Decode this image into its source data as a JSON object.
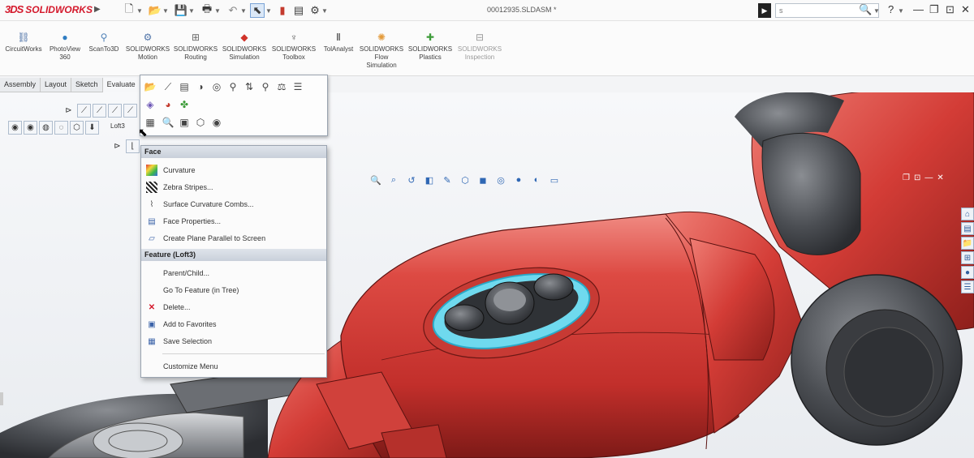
{
  "app": {
    "brand": "SOLIDWORKS",
    "brand_prefix": "3DS",
    "document_title": "00012935.SLDASM *"
  },
  "quick_access": [
    "new-icon",
    "open-icon",
    "save-icon",
    "print-icon",
    "undo-icon",
    "select-icon",
    "rebuild-icon",
    "file-properties-icon",
    "options-icon"
  ],
  "search": {
    "placeholder": "",
    "value": "s"
  },
  "window_controls": [
    "help-icon",
    "minimize-icon",
    "restore-icon",
    "close-icon"
  ],
  "command_manager": {
    "tools": [
      {
        "label": "CircuitWorks",
        "color": "#4a6fa5"
      },
      {
        "label": "PhotoView 360",
        "color": "#2f7dc2"
      },
      {
        "label": "ScanTo3D",
        "color": "#5082b8"
      },
      {
        "label": "SOLIDWORKS Motion",
        "color": "#4f73a8"
      },
      {
        "label": "SOLIDWORKS Routing",
        "color": "#6a6a6a"
      },
      {
        "label": "SOLIDWORKS Simulation",
        "color": "#d0332a"
      },
      {
        "label": "SOLIDWORKS Toolbox",
        "color": "#6b6b6b"
      },
      {
        "label": "TolAnalyst",
        "color": "#3b3b3b"
      },
      {
        "label": "SOLIDWORKS Flow Simulation",
        "color": "#e39a3a"
      },
      {
        "label": "SOLIDWORKS Plastics",
        "color": "#3e9c3a"
      },
      {
        "label": "SOLIDWORKS Inspection",
        "color": "#9a9a9a"
      }
    ]
  },
  "tabs": [
    "Assembly",
    "Layout",
    "Sketch",
    "Evaluate"
  ],
  "context_toolbar": {
    "selection_label": "Loft3"
  },
  "context_menu": {
    "sections": [
      {
        "header": "Face",
        "items": [
          {
            "label": "Curvature",
            "icon": "curvature-icon"
          },
          {
            "label": "Zebra Stripes...",
            "icon": "zebra-stripes-icon"
          },
          {
            "label": "Surface Curvature Combs...",
            "icon": "curvature-combs-icon"
          },
          {
            "label": "Face Properties...",
            "icon": "face-properties-icon"
          },
          {
            "label": "Create Plane Parallel to Screen",
            "icon": "plane-icon"
          }
        ]
      },
      {
        "header": "Feature (Loft3)",
        "items": [
          {
            "label": "Parent/Child...",
            "icon": ""
          },
          {
            "label": "Go To Feature (in Tree)",
            "icon": ""
          },
          {
            "label": "Delete...",
            "icon": "delete-icon"
          },
          {
            "label": "Add to Favorites",
            "icon": "favorites-icon"
          },
          {
            "label": "Save Selection",
            "icon": "save-selection-icon"
          }
        ]
      }
    ],
    "footer": "Customize Menu"
  },
  "colors": {
    "model_red": "#d8403c",
    "model_gray": "#4a4c4f",
    "highlight": "#67d6ec",
    "accent": "#d4182b"
  }
}
